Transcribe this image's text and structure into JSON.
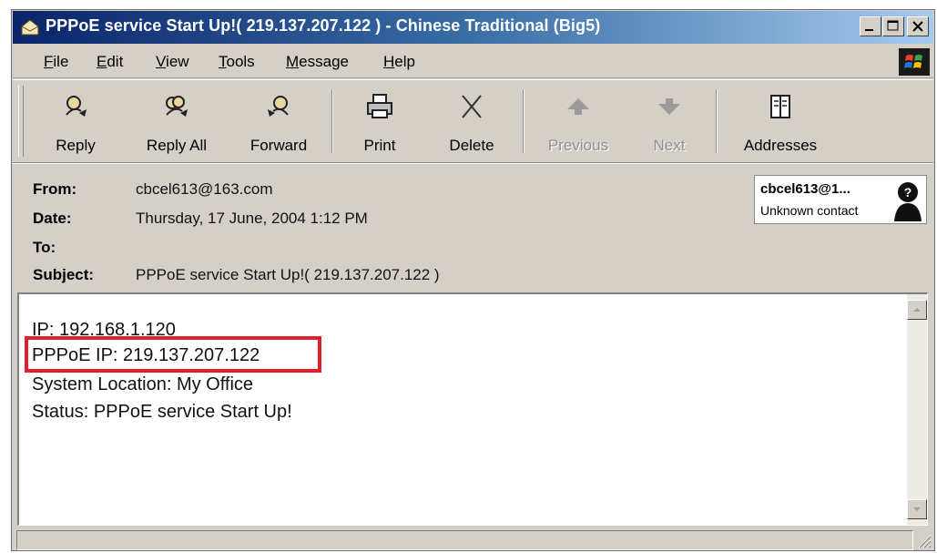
{
  "window": {
    "title": "PPPoE service Start Up!( 219.137.207.122 ) - Chinese Traditional (Big5)"
  },
  "menu": [
    {
      "label": "File",
      "accel": "F",
      "rest": "ile"
    },
    {
      "label": "Edit",
      "accel": "E",
      "rest": "dit"
    },
    {
      "label": "View",
      "accel": "V",
      "rest": "iew"
    },
    {
      "label": "Tools",
      "accel": "T",
      "rest": "ools"
    },
    {
      "label": "Message",
      "accel": "M",
      "rest": "essage"
    },
    {
      "label": "Help",
      "accel": "H",
      "rest": "elp"
    }
  ],
  "toolbar": {
    "reply": "Reply",
    "reply_all": "Reply All",
    "forward": "Forward",
    "print": "Print",
    "delete": "Delete",
    "previous": "Previous",
    "next": "Next",
    "addresses": "Addresses"
  },
  "header": {
    "from_label": "From:",
    "from": "cbcel613@163.com",
    "date_label": "Date:",
    "date": "Thursday, 17 June, 2004 1:12 PM",
    "to_label": "To:",
    "to": "",
    "subject_label": "Subject:",
    "subject": "PPPoE service Start Up!( 219.137.207.122 )"
  },
  "contact": {
    "name": "cbcel613@1...",
    "status": "Unknown contact"
  },
  "message": {
    "lines": [
      "IP: 192.168.1.120",
      "PPPoE IP: 219.137.207.122",
      "System Location: My Office",
      "Status: PPPoE service Start Up!"
    ]
  },
  "colors": {
    "highlight": "#e0202a",
    "titlebar_start": "#0a246a",
    "titlebar_end": "#a6caf0"
  },
  "icons": {
    "title": "envelope-icon",
    "reply": "reply-icon",
    "reply_all": "reply-all-icon",
    "forward": "forward-icon",
    "print": "printer-icon",
    "delete": "delete-x-icon",
    "previous": "up-arrow-icon",
    "next": "down-arrow-icon",
    "addresses": "address-book-icon"
  }
}
